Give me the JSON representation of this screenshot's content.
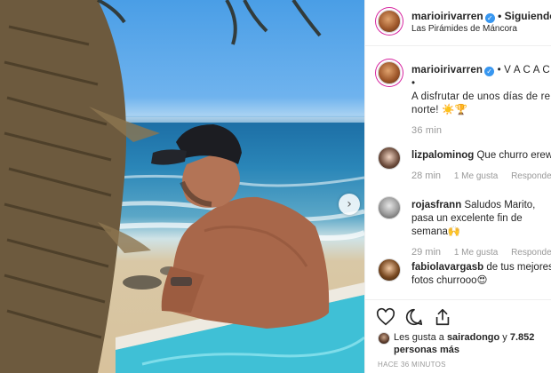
{
  "post": {
    "photo_alt": "",
    "next_icon": "chevron-right-icon",
    "next_glyph": "›"
  },
  "header": {
    "username": "marioirivarren",
    "separator": "•",
    "follow_status": "Siguiendo",
    "location": "Las Pirámides de Máncora"
  },
  "caption": {
    "username": "marioirivarren",
    "text_line1": "• V A C A C I O",
    "text_line2": "•",
    "text_line3": "A disfrutar de unos días de relajo",
    "text_line4": "norte! ☀️🏆",
    "time": "36 min"
  },
  "comments": [
    {
      "username": "lizpalominog",
      "text": "Que churro erew😍",
      "time": "28 min",
      "likes": "1 Me gusta",
      "reply": "Responder"
    },
    {
      "username": "rojasfrann",
      "text": "Saludos Marito, pasa un excelente fin de semana🙌",
      "time": "29 min",
      "likes": "1 Me gusta",
      "reply": "Responder"
    },
    {
      "username": "fabiolavargasb",
      "text": "de tus mejores fotos churrooo😍",
      "time": "",
      "likes": "",
      "reply": ""
    }
  ],
  "actions": {
    "like_icon": "heart-outline-icon",
    "comment_icon": "comment-bubble-icon",
    "share_icon": "share-icon"
  },
  "likes": {
    "prefix": "Les gusta a",
    "user": "sairadongo",
    "middle": "y",
    "others": "7.852 personas más"
  },
  "posted_time": "HACE 36 MINUTOS",
  "colors": {
    "verified": "#3897f0",
    "meta_gray": "#999999",
    "text": "#262626"
  }
}
